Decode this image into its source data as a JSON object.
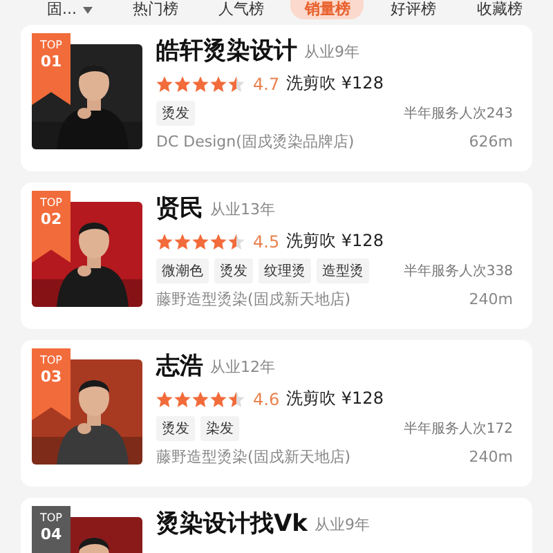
{
  "tabs": [
    {
      "label": "固...",
      "selected": false
    },
    {
      "label": "热门榜",
      "selected": false
    },
    {
      "label": "人气榜",
      "selected": false
    },
    {
      "label": "销量榜",
      "selected": true
    },
    {
      "label": "好评榜",
      "selected": false
    },
    {
      "label": "收藏榜",
      "selected": false
    }
  ],
  "stylists": [
    {
      "top": "TOP",
      "rank": "01",
      "color": "#f26b3a",
      "name": "皓轩烫染设计",
      "years": "从业9年",
      "stars": 4.5,
      "rating": "4.7",
      "price": "洗剪吹 ¥128",
      "tags": [
        "烫发"
      ],
      "served": "半年服务人次243",
      "shop": "DC Design(固戍烫染品牌店)",
      "distance": "626m"
    },
    {
      "top": "TOP",
      "rank": "02",
      "color": "#f26b3a",
      "name": "贤民",
      "years": "从业13年",
      "stars": 4.5,
      "rating": "4.5",
      "price": "洗剪吹 ¥128",
      "tags": [
        "微潮色",
        "烫发",
        "纹理烫",
        "造型烫"
      ],
      "served": "半年服务人次338",
      "shop": "藤野造型烫染(固戍新天地店)",
      "distance": "240m"
    },
    {
      "top": "TOP",
      "rank": "03",
      "color": "#f26b3a",
      "name": "志浩",
      "years": "从业12年",
      "stars": 4.5,
      "rating": "4.6",
      "price": "洗剪吹 ¥128",
      "tags": [
        "烫发",
        "染发"
      ],
      "served": "半年服务人次172",
      "shop": "藤野造型烫染(固戍新天地店)",
      "distance": "240m"
    },
    {
      "top": "TOP",
      "rank": "04",
      "color": "#5a5a5a",
      "name": "烫染设计找Vk",
      "years": "从业9年"
    }
  ]
}
